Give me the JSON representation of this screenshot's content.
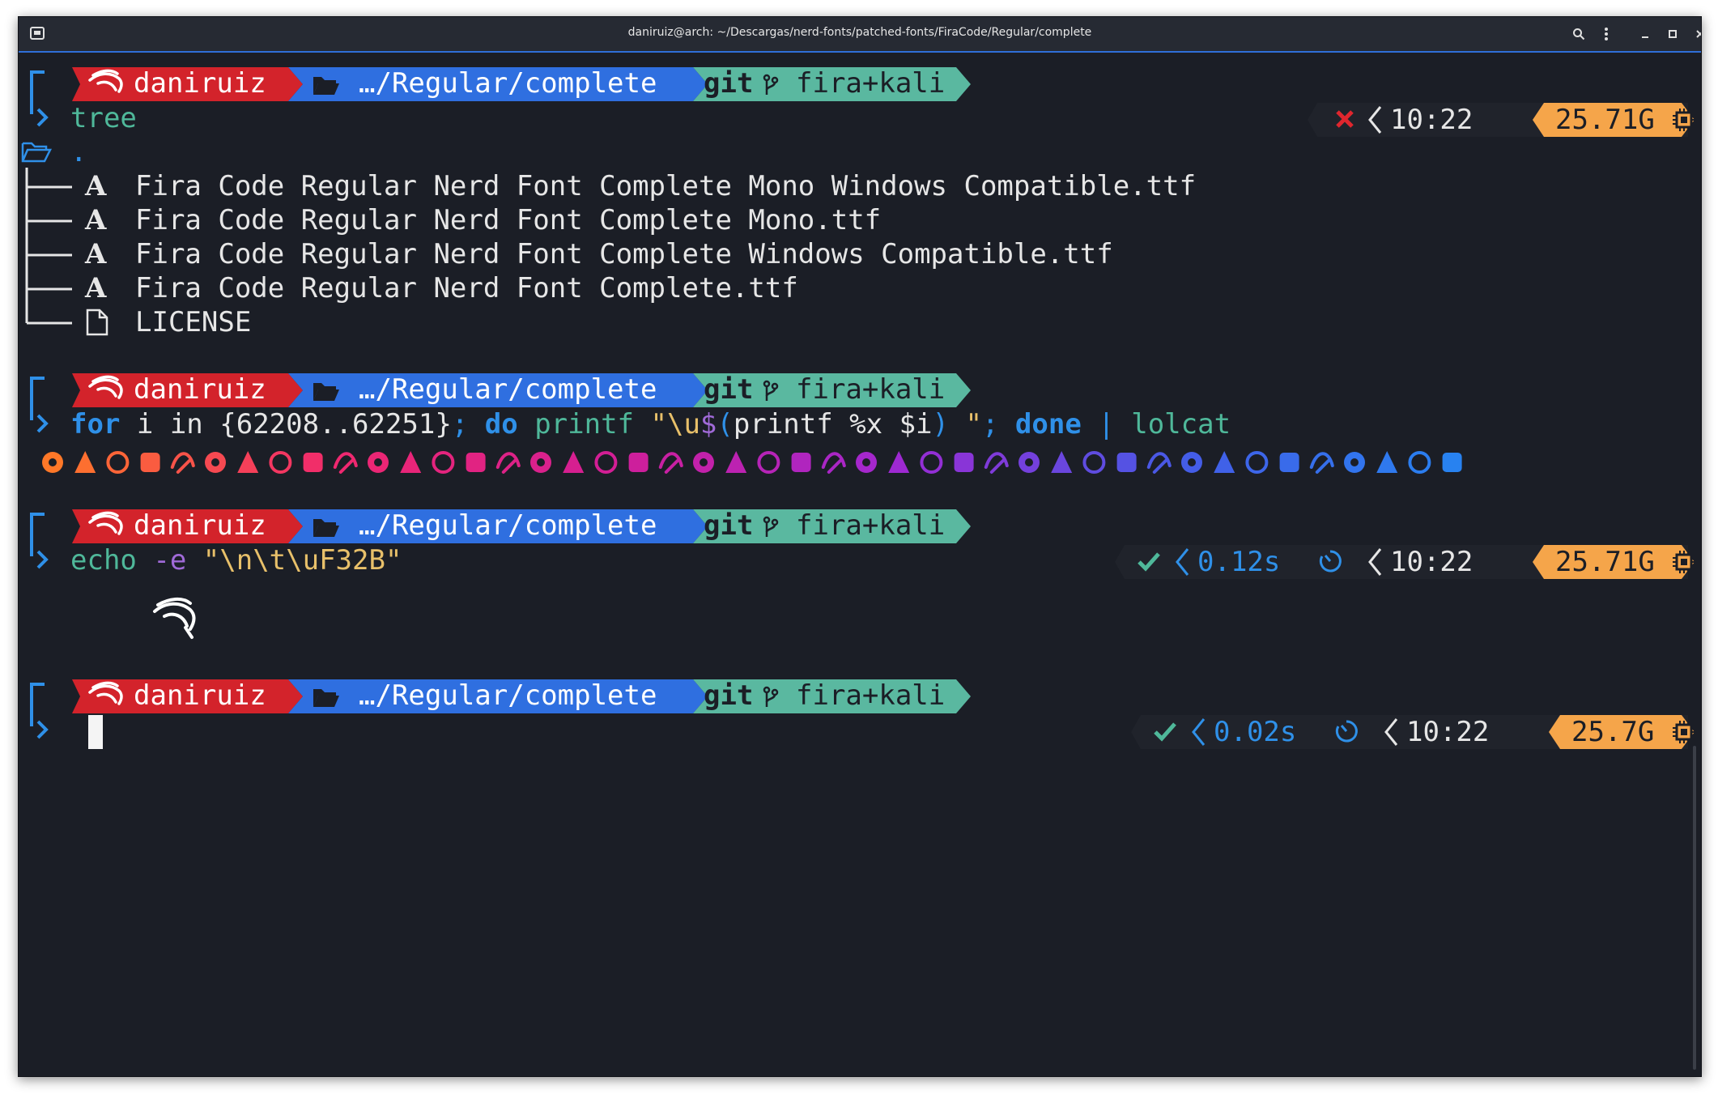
{
  "window": {
    "title": "daniruiz@arch: ~/Descargas/nerd-fonts/patched-fonts/FiraCode/Regular/complete"
  },
  "colors": {
    "bg": "#1b1e26",
    "user_seg": "#d3232b",
    "dir_seg": "#2f6fe0",
    "git_seg": "#5ab8a0",
    "mem_seg": "#f5a54a",
    "text": "#c9ccd3",
    "keyword": "#2f90e8",
    "green": "#4fb89a",
    "purple": "#a06ad8"
  },
  "prompt": {
    "user": "daniruiz",
    "dir": "…/Regular/complete",
    "git_label": "git",
    "branch": "fira+kali"
  },
  "block1": {
    "command": "tree",
    "status_icon": "x-icon",
    "time": "10:22",
    "mem": "25.71G",
    "root": ".",
    "files": [
      "Fira Code Regular Nerd Font Complete Mono Windows Compatible.ttf",
      "Fira Code Regular Nerd Font Complete Mono.ttf",
      "Fira Code Regular Nerd Font Complete Windows Compatible.ttf",
      "Fira Code Regular Nerd Font Complete.ttf"
    ],
    "license": "LICENSE"
  },
  "block2": {
    "cmd_for": "for",
    "cmd_i_in": " i in ",
    "cmd_range": "{62208..62251}",
    "cmd_semi1": ";",
    "cmd_do": " do",
    "cmd_printf": " printf",
    "cmd_str1": " \"\\u",
    "cmd_dollar": "$",
    "cmd_paren": "(",
    "cmd_inner": "printf %x $i",
    "cmd_paren2": ")",
    "cmd_str2": " \"",
    "cmd_semi2": ";",
    "cmd_done": " done",
    "cmd_pipe": " |",
    "cmd_lolcat": " lolcat"
  },
  "block3": {
    "cmd_echo": "echo",
    "cmd_flag": " -e",
    "cmd_str": " \"\\n\\t\\uF32B\"",
    "duration": "0.12s",
    "time": "10:22",
    "mem": "25.71G"
  },
  "block4": {
    "duration": "0.02s",
    "time": "10:22",
    "mem": "25.7G"
  }
}
